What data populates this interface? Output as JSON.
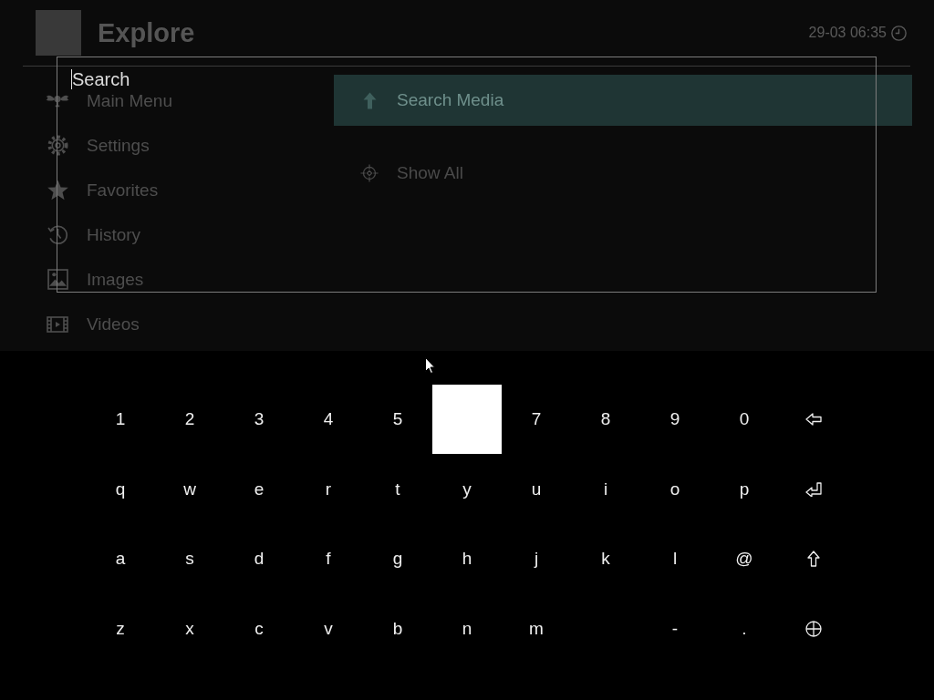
{
  "header": {
    "title": "Explore",
    "datetime": "29-03 06:35"
  },
  "sidebar": {
    "items": [
      {
        "label": "Main Menu"
      },
      {
        "label": "Settings"
      },
      {
        "label": "Favorites"
      },
      {
        "label": "History"
      },
      {
        "label": "Images"
      },
      {
        "label": "Videos"
      }
    ]
  },
  "content": {
    "items": [
      {
        "label": "Search Media",
        "selected": true
      },
      {
        "label": "Show All",
        "selected": false
      }
    ]
  },
  "search_dialog": {
    "placeholder": "Search"
  },
  "keyboard": {
    "rows": [
      [
        {
          "kind": "char",
          "label": "1",
          "selected": false
        },
        {
          "kind": "char",
          "label": "2",
          "selected": false
        },
        {
          "kind": "char",
          "label": "3",
          "selected": false
        },
        {
          "kind": "char",
          "label": "4",
          "selected": false
        },
        {
          "kind": "char",
          "label": "5",
          "selected": false
        },
        {
          "kind": "char",
          "selected": true
        },
        {
          "kind": "char",
          "label": "7",
          "selected": false
        },
        {
          "kind": "char",
          "label": "8",
          "selected": false
        },
        {
          "kind": "char",
          "label": "9",
          "selected": false
        },
        {
          "kind": "char",
          "label": "0",
          "selected": false
        },
        {
          "kind": "backspace",
          "selected": false
        }
      ],
      [
        {
          "kind": "char",
          "label": "q",
          "selected": false
        },
        {
          "kind": "char",
          "label": "w",
          "selected": false
        },
        {
          "kind": "char",
          "label": "e",
          "selected": false
        },
        {
          "kind": "char",
          "label": "r",
          "selected": false
        },
        {
          "kind": "char",
          "label": "t",
          "selected": false
        },
        {
          "kind": "char",
          "label": "y",
          "selected": false
        },
        {
          "kind": "char",
          "label": "u",
          "selected": false
        },
        {
          "kind": "char",
          "label": "i",
          "selected": false
        },
        {
          "kind": "char",
          "label": "o",
          "selected": false
        },
        {
          "kind": "char",
          "label": "p",
          "selected": false
        },
        {
          "kind": "enter",
          "selected": false
        }
      ],
      [
        {
          "kind": "char",
          "label": "a",
          "selected": false
        },
        {
          "kind": "char",
          "label": "s",
          "selected": false
        },
        {
          "kind": "char",
          "label": "d",
          "selected": false
        },
        {
          "kind": "char",
          "label": "f",
          "selected": false
        },
        {
          "kind": "char",
          "label": "g",
          "selected": false
        },
        {
          "kind": "char",
          "label": "h",
          "selected": false
        },
        {
          "kind": "char",
          "label": "j",
          "selected": false
        },
        {
          "kind": "char",
          "label": "k",
          "selected": false
        },
        {
          "kind": "char",
          "label": "l",
          "selected": false
        },
        {
          "kind": "char",
          "label": "@",
          "selected": false
        },
        {
          "kind": "shift",
          "selected": false
        }
      ],
      [
        {
          "kind": "char",
          "label": "z",
          "selected": false
        },
        {
          "kind": "char",
          "label": "x",
          "selected": false
        },
        {
          "kind": "char",
          "label": "c",
          "selected": false
        },
        {
          "kind": "char",
          "label": "v",
          "selected": false
        },
        {
          "kind": "char",
          "label": "b",
          "selected": false
        },
        {
          "kind": "char",
          "label": "n",
          "selected": false
        },
        {
          "kind": "char",
          "label": "m",
          "selected": false
        },
        {
          "kind": "blank"
        },
        {
          "kind": "char",
          "label": "-",
          "selected": false
        },
        {
          "kind": "char",
          "label": ".",
          "selected": false
        },
        {
          "kind": "language",
          "selected": false
        }
      ]
    ]
  }
}
